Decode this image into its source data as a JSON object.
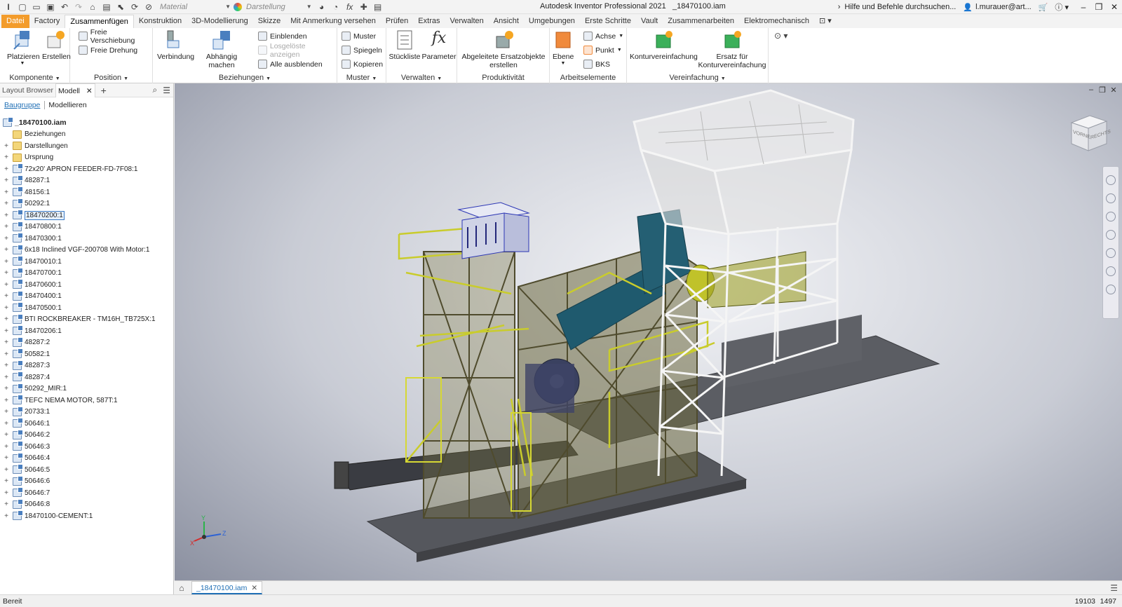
{
  "title": {
    "app": "Autodesk Inventor Professional 2021",
    "document": "_18470100.iam",
    "material_label": "Material",
    "appearance_label": "Darstellung",
    "help_search": "Hilfe und Befehle durchsuchen...",
    "user": "l.murauer@art..."
  },
  "tabs": [
    "Datei",
    "Factory",
    "Zusammenfügen",
    "Konstruktion",
    "3D-Modellierung",
    "Skizze",
    "Mit Anmerkung versehen",
    "Prüfen",
    "Extras",
    "Verwalten",
    "Ansicht",
    "Umgebungen",
    "Erste Schritte",
    "Vault",
    "Zusammenarbeiten",
    "Elektromechanisch"
  ],
  "ribbon": {
    "komponente": {
      "title": "Komponente",
      "platzieren": "Platzieren",
      "erstellen": "Erstellen"
    },
    "position": {
      "title": "Position",
      "freie_verschiebung": "Freie Verschiebung",
      "freie_drehung": "Freie Drehung"
    },
    "beziehungen": {
      "title": "Beziehungen",
      "verbindung": "Verbindung",
      "abhaengig": "Abhängig machen",
      "einblenden": "Einblenden",
      "losgeloeste": "Losgelöste anzeigen",
      "alle_ausblenden": "Alle ausblenden"
    },
    "muster": {
      "title": "Muster",
      "muster": "Muster",
      "spiegeln": "Spiegeln",
      "kopieren": "Kopieren"
    },
    "verwalten": {
      "title": "Verwalten",
      "stueckliste": "Stückliste",
      "parameter": "Parameter"
    },
    "produktivitaet": {
      "title": "Produktivität",
      "abgeleitete_1": "Abgeleitete Ersatzobjekte",
      "abgeleitete_2": "erstellen"
    },
    "arbeitselemente": {
      "title": "Arbeitselemente",
      "ebene": "Ebene",
      "achse": "Achse",
      "punkt": "Punkt",
      "bks": "BKS"
    },
    "vereinfachung": {
      "title": "Vereinfachung",
      "konturvereinfachung": "Konturvereinfachung",
      "ersatz_1": "Ersatz für",
      "ersatz_2": "Konturvereinfachung"
    }
  },
  "browser": {
    "tab_layout": "Layout Browser",
    "tab_model": "Modell",
    "mode_assembly": "Baugruppe",
    "mode_modeling": "Modellieren",
    "root": "_18470100.iam",
    "items": [
      {
        "label": "Beziehungen",
        "icon": "folder"
      },
      {
        "label": "Darstellungen",
        "icon": "folder"
      },
      {
        "label": "Ursprung",
        "icon": "folder"
      },
      {
        "label": "72x20' APRON FEEDER-FD-7F08:1",
        "icon": "assembly"
      },
      {
        "label": "48287:1",
        "icon": "assembly"
      },
      {
        "label": "48156:1",
        "icon": "assembly"
      },
      {
        "label": "50292:1",
        "icon": "assembly"
      },
      {
        "label": "18470200:1",
        "icon": "assembly"
      },
      {
        "label": "18470800:1",
        "icon": "assembly"
      },
      {
        "label": "18470300:1",
        "icon": "assembly"
      },
      {
        "label": "6x18 Inclined VGF-200708 With Motor:1",
        "icon": "assembly"
      },
      {
        "label": "18470010:1",
        "icon": "assembly"
      },
      {
        "label": "18470700:1",
        "icon": "assembly"
      },
      {
        "label": "18470600:1",
        "icon": "assembly"
      },
      {
        "label": "18470400:1",
        "icon": "assembly"
      },
      {
        "label": "18470500:1",
        "icon": "assembly"
      },
      {
        "label": "BTI ROCKBREAKER - TM16H_TB725X:1",
        "icon": "assembly"
      },
      {
        "label": "18470206:1",
        "icon": "assembly"
      },
      {
        "label": "48287:2",
        "icon": "assembly"
      },
      {
        "label": "50582:1",
        "icon": "assembly"
      },
      {
        "label": "48287:3",
        "icon": "assembly"
      },
      {
        "label": "48287:4",
        "icon": "assembly"
      },
      {
        "label": "50292_MIR:1",
        "icon": "assembly"
      },
      {
        "label": "TEFC NEMA MOTOR, 587T:1",
        "icon": "assembly"
      },
      {
        "label": "20733:1",
        "icon": "assembly"
      },
      {
        "label": "50646:1",
        "icon": "assembly"
      },
      {
        "label": "50646:2",
        "icon": "assembly"
      },
      {
        "label": "50646:3",
        "icon": "assembly"
      },
      {
        "label": "50646:4",
        "icon": "assembly"
      },
      {
        "label": "50646:5",
        "icon": "assembly"
      },
      {
        "label": "50646:6",
        "icon": "assembly"
      },
      {
        "label": "50646:7",
        "icon": "assembly"
      },
      {
        "label": "50646:8",
        "icon": "assembly"
      },
      {
        "label": "18470100-CEMENT:1",
        "icon": "assembly"
      }
    ]
  },
  "viewcube": {
    "face_front": "VORNE",
    "face_right": "RECHTS"
  },
  "triad": {
    "x": "X",
    "y": "Y",
    "z": "Z"
  },
  "doc_tab": "_18470100.iam",
  "status": {
    "left": "Bereit",
    "count1": "19103",
    "count2": "1497"
  },
  "colors": {
    "file_tab": "#f39c2b",
    "accent": "#1f6fb5",
    "steel": "#6e6a3f",
    "rail": "#d6d834",
    "hopper": "#ffffff",
    "concrete": "#5b5d63"
  }
}
